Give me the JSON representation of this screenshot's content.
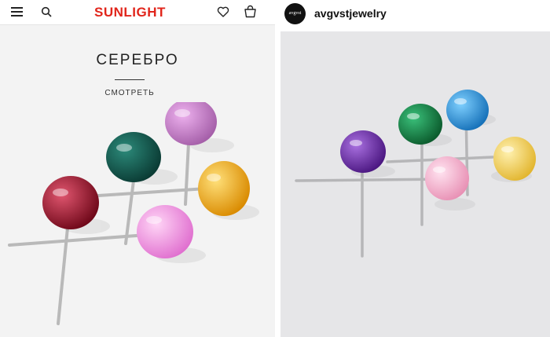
{
  "left_page": {
    "brand": "SUNLIGHT",
    "icons": [
      "menu-icon",
      "search-icon",
      "heart-icon",
      "bag-icon"
    ],
    "promo_title": "СЕРЕБРО",
    "promo_link": "СМОТРЕТЬ"
  },
  "right_page": {
    "avatar_text": "avgvst",
    "username": "avgvstjewelry"
  },
  "colors": {
    "brand_red": "#e1251b",
    "gem_red": "#a8102a",
    "gem_green": "#0f5a4e",
    "gem_violet": "#c27bc4",
    "gem_yellow": "#f2b21c",
    "gem_pink": "#f19be0",
    "gem_purple": "#6a28a8",
    "gem_blue": "#2a9ad6"
  }
}
